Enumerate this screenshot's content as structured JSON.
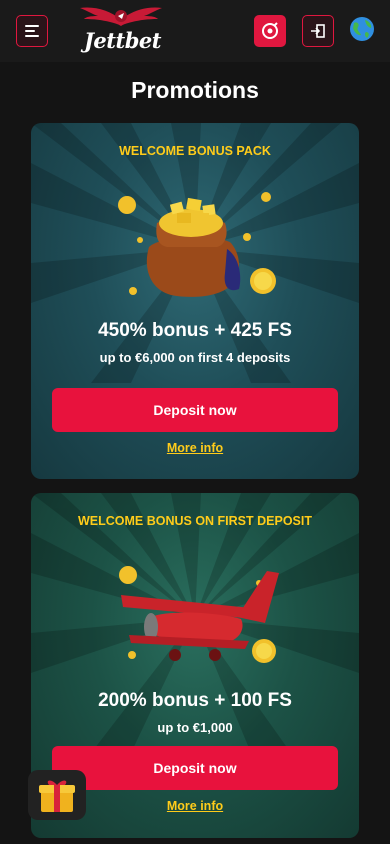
{
  "header": {
    "brand": "Jettbet",
    "icons": [
      "menu-icon",
      "support-icon",
      "login-icon",
      "globe-icon"
    ]
  },
  "page": {
    "title": "Promotions"
  },
  "promotions": [
    {
      "label": "WELCOME BONUS PACK",
      "title": "450% bonus + 425 FS",
      "subtitle": "up to €6,000 on first 4 deposits",
      "cta": "Deposit now",
      "more": "More info",
      "image": "pot-of-gold-icon"
    },
    {
      "label": "WELCOME BONUS ON FIRST DEPOSIT",
      "title": "200% bonus + 100 FS",
      "subtitle": "up to €1,000",
      "cta": "Deposit now",
      "more": "More info",
      "image": "red-plane-icon"
    }
  ],
  "colors": {
    "accent": "#e8123d",
    "label": "#ffcc1a",
    "background": "#141414"
  }
}
